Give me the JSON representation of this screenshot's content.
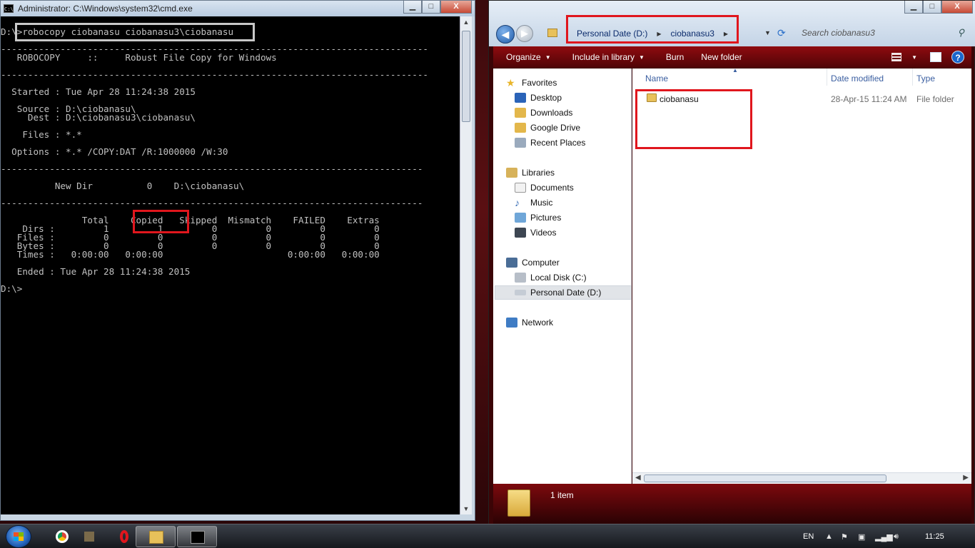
{
  "cmd_window": {
    "title": "Administrator: C:\\Windows\\system32\\cmd.exe",
    "icon": "C:\\",
    "controls": {
      "minimize": "▁",
      "maximize": "□",
      "close": "X"
    },
    "lines": [
      "D:\\>robocopy ciobanasu ciobanasu3\\ciobanasu",
      "",
      "-------------------------------------------------------------------------------",
      "   ROBOCOPY     ::     Robust File Copy for Windows",
      "",
      "-------------------------------------------------------------------------------",
      "",
      "  Started : Tue Apr 28 11:24:38 2015",
      "",
      "   Source : D:\\ciobanasu\\",
      "     Dest : D:\\ciobanasu3\\ciobanasu\\",
      "",
      "    Files : *.*",
      "",
      "  Options : *.* /COPY:DAT /R:1000000 /W:30",
      "",
      "------------------------------------------------------------------------------",
      "",
      "          New Dir          0    D:\\ciobanasu\\",
      "",
      "------------------------------------------------------------------------------",
      "",
      "               Total    Copied   Skipped  Mismatch    FAILED    Extras",
      "    Dirs :         1         1         0         0         0         0",
      "   Files :         0         0         0         0         0         0",
      "   Bytes :         0         0         0         0         0         0",
      "   Times :   0:00:00   0:00:00                       0:00:00   0:00:00",
      "",
      "   Ended : Tue Apr 28 11:24:38 2015",
      "",
      "D:\\>"
    ]
  },
  "explorer": {
    "breadcrumb": [
      "Personal Date (D:)",
      "ciobanasu3"
    ],
    "search_placeholder": "Search ciobanasu3",
    "toolbar": {
      "organize": "Organize",
      "include_in_library": "Include in library",
      "burn": "Burn",
      "new_folder": "New folder"
    },
    "nav": {
      "favorites": "Favorites",
      "desktop": "Desktop",
      "downloads": "Downloads",
      "google_drive": "Google Drive",
      "recent_places": "Recent Places",
      "libraries": "Libraries",
      "documents": "Documents",
      "music": "Music",
      "pictures": "Pictures",
      "videos": "Videos",
      "computer": "Computer",
      "local_disk": "Local Disk (C:)",
      "personal_date": "Personal Date (D:)",
      "network": "Network"
    },
    "columns": {
      "name": "Name",
      "date_modified": "Date modified",
      "type": "Type"
    },
    "files": [
      {
        "name": "ciobanasu",
        "date_modified": "28-Apr-15 11:24 AM",
        "type": "File folder"
      }
    ],
    "status": "1 item"
  },
  "taskbar": {
    "language": "EN",
    "time": "11:25"
  },
  "colors": {
    "highlight_red": "#e0161d",
    "highlight_gray": "#c8c8c8",
    "theme_red": "#8f0b0f"
  }
}
